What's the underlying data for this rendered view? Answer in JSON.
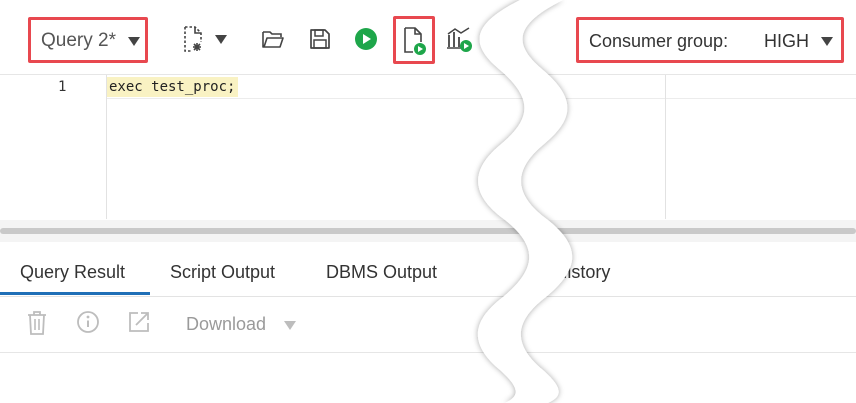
{
  "toolbar": {
    "query_tab": "Query 2*",
    "consumer_group_label": "Consumer group:",
    "consumer_group_value": "HIGH"
  },
  "icons": {
    "new": "new-file-icon",
    "open": "folder-open-icon",
    "save": "save-icon",
    "run": "run-statement-icon",
    "run_script": "run-script-icon",
    "explain": "explain-plan-icon",
    "delete": "trash-icon",
    "info": "info-icon",
    "open_external": "open-external-icon"
  },
  "editor": {
    "line_number": "1",
    "code": "exec test_proc;"
  },
  "tabs": [
    {
      "label": "Query Result",
      "active": true
    },
    {
      "label": "Script Output",
      "active": false
    },
    {
      "label": "DBMS Output",
      "active": false
    },
    {
      "label": "L History",
      "active": false
    }
  ],
  "results": {
    "download_label": "Download"
  },
  "colors": {
    "highlight_box": "#e8484f",
    "run_green": "#1ea64a",
    "active_tab": "#1f6fb7",
    "code_highlight": "#f9f2c3"
  }
}
